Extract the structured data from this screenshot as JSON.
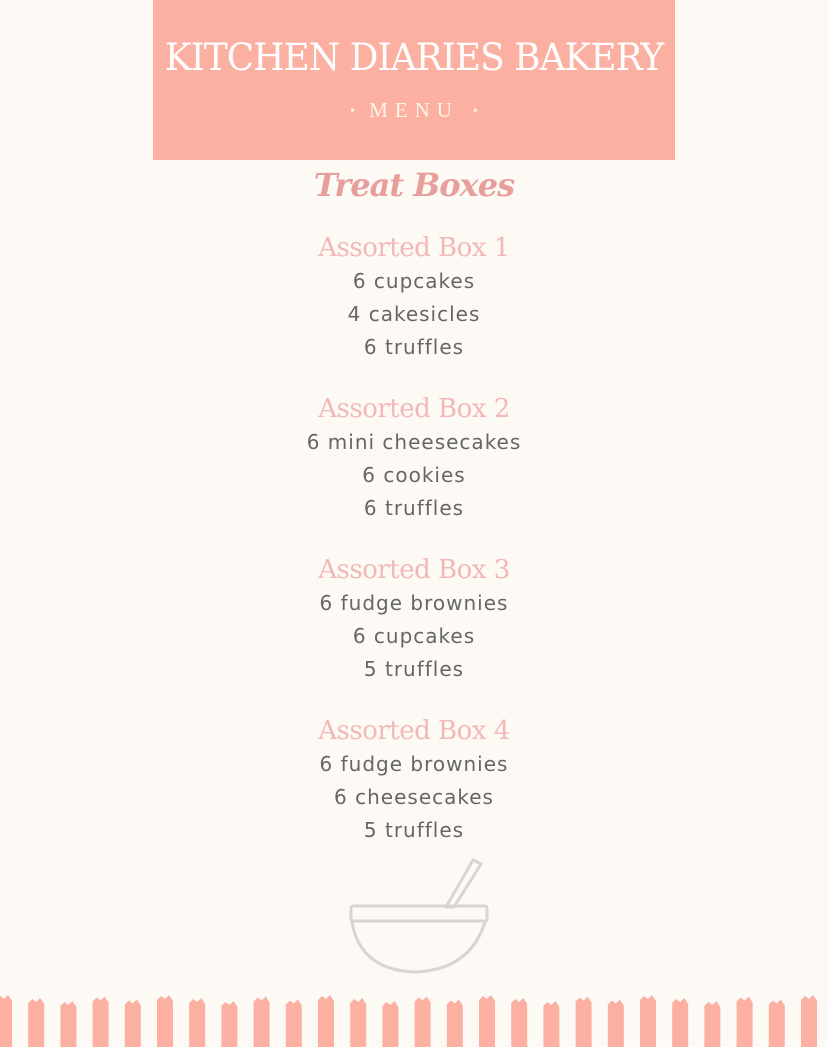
{
  "header": {
    "title": "KITCHEN DIARIES BAKERY",
    "subtitle": "MENU",
    "background": "#fbb0a2"
  },
  "section_title": "Treat Boxes",
  "boxes": [
    {
      "name": "Assorted Box 1",
      "items": [
        "6 cupcakes",
        "4 cakesicles",
        "6 truffles"
      ]
    },
    {
      "name": "Assorted Box 2",
      "items": [
        "6 mini cheesecakes",
        "6 cookies",
        "6 truffles"
      ]
    },
    {
      "name": "Assorted Box 3",
      "items": [
        "6 fudge brownies",
        "6 cupcakes",
        "5 truffles"
      ]
    },
    {
      "name": "Assorted Box 4",
      "items": [
        "6 fudge brownies",
        "6 cheesecakes",
        "5 truffles"
      ]
    }
  ],
  "decor": {
    "icon": "mixing-bowl-icon",
    "stripe_color": "#fbb0a2"
  }
}
